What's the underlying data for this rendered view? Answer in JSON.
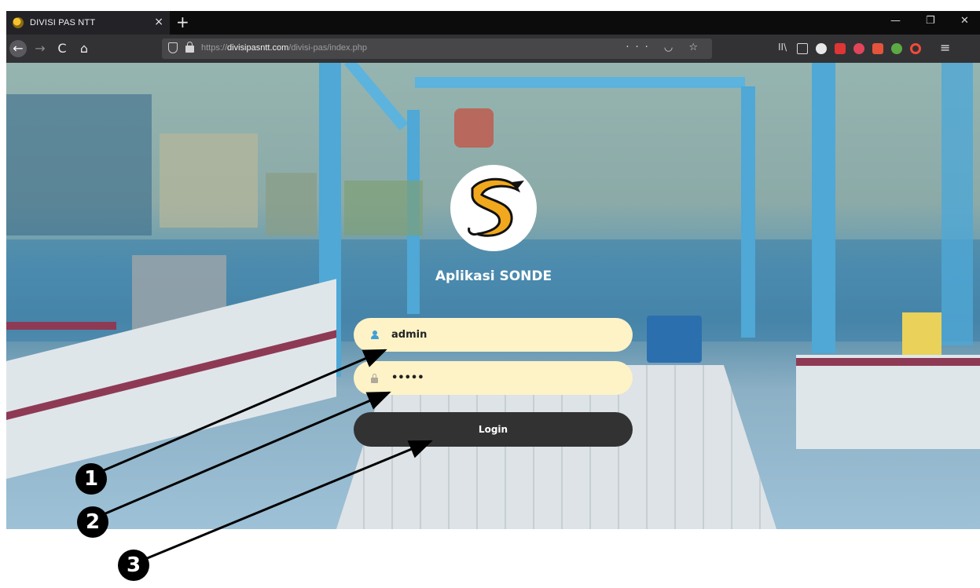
{
  "browser": {
    "tab_title": "DIVISI PAS NTT",
    "tab_close": "×",
    "new_tab": "+",
    "url_prefix": "https://",
    "url_host": "divisipasntt.com",
    "url_path": "/divisi-pas/index.php",
    "url_actions": "··· ◡ ☆",
    "window_controls": {
      "minimize": "—",
      "maximize": "❐",
      "close": "✕"
    },
    "nav": {
      "back": "←",
      "forward": "→",
      "reload": "C",
      "home": "⌂"
    },
    "toolbar": {
      "library": "II\\",
      "menu": "≡"
    }
  },
  "login": {
    "app_title": "Aplikasi SONDE",
    "username_value": "admin",
    "password_value": "admin",
    "login_label": "Login"
  },
  "annotations": {
    "badge_1": "1",
    "badge_2": "2",
    "badge_3": "3"
  },
  "colors": {
    "field_bg": "#fdf3c7",
    "button_bg": "#333232",
    "overlay_tint": "#2882be"
  }
}
